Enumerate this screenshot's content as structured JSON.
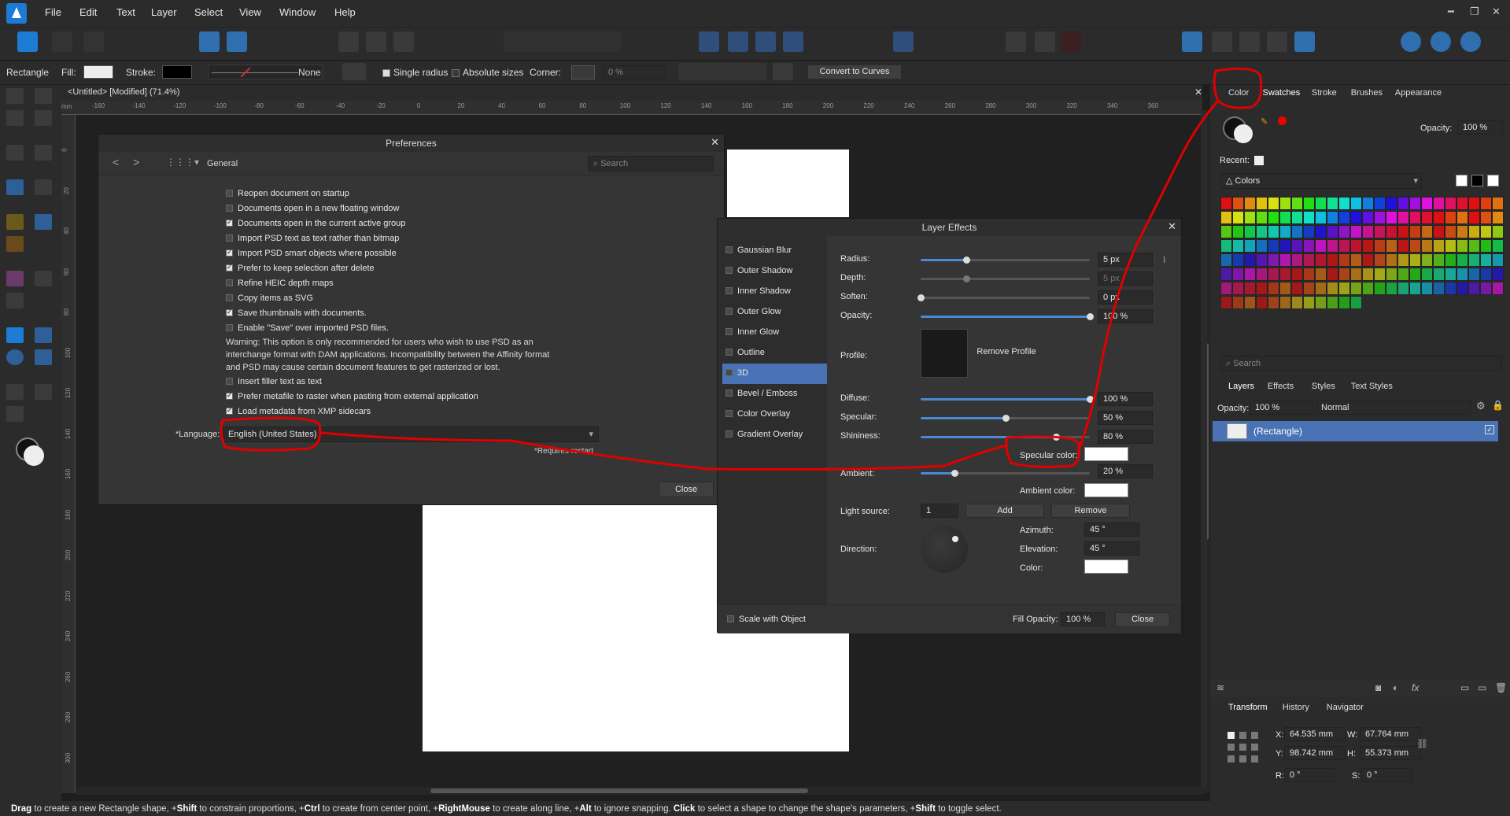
{
  "menu": [
    "File",
    "Edit",
    "Text",
    "Layer",
    "Select",
    "View",
    "Window",
    "Help"
  ],
  "context": {
    "tool": "Rectangle",
    "fill_label": "Fill:",
    "stroke_label": "Stroke:",
    "stroke_none": "None",
    "single_radius": "Single radius",
    "absolute_sizes": "Absolute sizes",
    "corner_label": "Corner:",
    "corner_value": "0 %",
    "convert": "Convert to Curves"
  },
  "document_tab": "<Untitled> [Modified] (71.4%)",
  "ruler": {
    "unit": "mm",
    "top": [
      "-160",
      "-140",
      "-120",
      "-100",
      "-80",
      "-60",
      "-40",
      "-20",
      "0",
      "20",
      "40",
      "60",
      "80",
      "100",
      "120",
      "140",
      "160",
      "180",
      "200",
      "220",
      "240",
      "260",
      "280",
      "300",
      "320",
      "340",
      "360"
    ],
    "left": [
      "0",
      "20",
      "40",
      "60",
      "80",
      "100",
      "120",
      "140",
      "160",
      "180",
      "200",
      "220",
      "240",
      "260",
      "280",
      "300"
    ]
  },
  "preferences": {
    "title": "Preferences",
    "section": "General",
    "search_placeholder": "Search",
    "options": [
      {
        "label": "Reopen document on startup",
        "checked": false
      },
      {
        "label": "Documents open in a new floating window",
        "checked": false
      },
      {
        "label": "Documents open in the current active group",
        "checked": true
      },
      {
        "label": "Import PSD text as text rather than bitmap",
        "checked": false
      },
      {
        "label": "Import PSD smart objects where possible",
        "checked": true
      },
      {
        "label": "Prefer to keep selection after delete",
        "checked": true
      },
      {
        "label": "Refine HEIC depth maps",
        "checked": false
      },
      {
        "label": "Copy items as SVG",
        "checked": false
      },
      {
        "label": "Save thumbnails with documents.",
        "checked": true
      },
      {
        "label": "Enable \"Save\" over imported PSD files.",
        "checked": false
      }
    ],
    "warning": [
      "Warning: This option is only recommended for users who wish to use PSD as an",
      "interchange format with DAM applications. Incompatibility between the Affinity format",
      "and PSD may cause certain document features to get rasterized or lost."
    ],
    "options2": [
      {
        "label": "Insert filler text as text",
        "checked": false
      },
      {
        "label": "Prefer metafile to raster when pasting from external application",
        "checked": true
      },
      {
        "label": "Load metadata from XMP sidecars",
        "checked": true
      }
    ],
    "language_label": "*Language:",
    "language_value": "English (United States)",
    "requires_restart": "*Requires restart",
    "close": "Close"
  },
  "layer_effects": {
    "title": "Layer Effects",
    "effects": [
      "Gaussian Blur",
      "Outer Shadow",
      "Inner Shadow",
      "Outer Glow",
      "Inner Glow",
      "Outline",
      "3D",
      "Bevel / Emboss",
      "Color Overlay",
      "Gradient Overlay"
    ],
    "selected": "3D",
    "radius_label": "Radius:",
    "radius_value": "5 px",
    "depth_label": "Depth:",
    "depth_value": "5 px",
    "soften_label": "Soften:",
    "soften_value": "0 px",
    "opacity_label": "Opacity:",
    "opacity_value": "100 %",
    "profile_label": "Profile:",
    "remove_profile": "Remove Profile",
    "diffuse_label": "Diffuse:",
    "diffuse_value": "100 %",
    "specular_label": "Specular:",
    "specular_value": "50 %",
    "shininess_label": "Shininess:",
    "shininess_value": "80 %",
    "specular_color_label": "Specular color:",
    "ambient_label": "Ambient:",
    "ambient_value": "20 %",
    "ambient_color_label": "Ambient color:",
    "light_source_label": "Light source:",
    "light_source_value": "1",
    "add": "Add",
    "remove": "Remove",
    "direction_label": "Direction:",
    "azimuth_label": "Azimuth:",
    "azimuth_value": "45 °",
    "elevation_label": "Elevation:",
    "elevation_value": "45 °",
    "color_label": "Color:",
    "scale_with_object": "Scale with Object",
    "fill_opacity_label": "Fill Opacity:",
    "fill_opacity_value": "100 %",
    "close": "Close",
    "sliders": {
      "radius": 0.27,
      "depth": 0.27,
      "soften": 0.0,
      "opacity": 1.0,
      "diffuse": 1.0,
      "specular": 0.5,
      "shininess": 0.8,
      "ambient": 0.2
    }
  },
  "color_panel": {
    "tabs": [
      "Color",
      "Swatches",
      "Stroke",
      "Brushes",
      "Appearance"
    ],
    "active_tab": "Swatches",
    "opacity_label": "Opacity:",
    "opacity_value": "100 %",
    "recent_label": "Recent:",
    "palette_name": "Colors",
    "search_placeholder": "Search",
    "palette_colors": [
      "#e01010",
      "#e05010",
      "#e08a10",
      "#e0c010",
      "#d8e010",
      "#a0e010",
      "#60e010",
      "#20e010",
      "#10e050",
      "#10e090",
      "#10e0c8",
      "#10c0e0",
      "#1080e0",
      "#1040e0",
      "#2010e0",
      "#6010e0",
      "#a010e0",
      "#e010e0",
      "#e010a0",
      "#e01060",
      "#e01030",
      "#e01010",
      "#e04010",
      "#e07010"
    ]
  },
  "layers_panel": {
    "tabs": [
      "Layers",
      "Effects",
      "Styles",
      "Text Styles"
    ],
    "opacity_label": "Opacity:",
    "opacity_value": "100 %",
    "blend_mode": "Normal",
    "layer_name": "(Rectangle)"
  },
  "transform_panel": {
    "tabs": [
      "Transform",
      "History",
      "Navigator"
    ],
    "x_label": "X:",
    "x_value": "64.535 mm",
    "y_label": "Y:",
    "y_value": "98.742 mm",
    "w_label": "W:",
    "w_value": "67.764 mm",
    "h_label": "H:",
    "h_value": "55.373 mm",
    "r_label": "R:",
    "r_value": "0 °",
    "s_label": "S:",
    "s_value": "0 °"
  },
  "status": {
    "parts": [
      {
        "b": "Drag",
        "t": " to create a new Rectangle shape, +"
      },
      {
        "b": "Shift",
        "t": " to constrain proportions, +"
      },
      {
        "b": "Ctrl",
        "t": " to create from center point, +"
      },
      {
        "b": "RightMouse",
        "t": " to create along line, +"
      },
      {
        "b": "Alt",
        "t": " to ignore snapping. "
      },
      {
        "b": "Click",
        "t": " to select a shape to change the shape's parameters, +"
      },
      {
        "b": "Shift",
        "t": " to toggle select."
      }
    ]
  },
  "colors": {
    "accent": "#4a73b5",
    "annotation": "#e00000",
    "panel": "#2b2b2b",
    "dialog": "#353535"
  }
}
